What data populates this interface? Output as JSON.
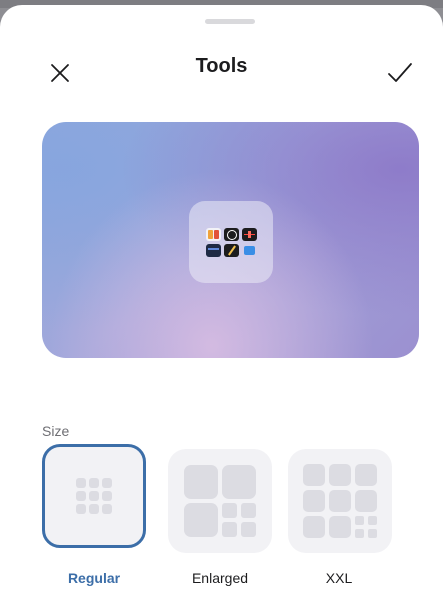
{
  "header": {
    "title": "Tools",
    "close_icon": "close-icon",
    "confirm_icon": "checkmark-icon"
  },
  "preview": {
    "folder_apps": [
      "finder-app-icon",
      "clock-app-icon",
      "voice-memos-app-icon",
      "notes-app-icon",
      "pencil-app-icon",
      "screen-app-icon"
    ]
  },
  "size_section": {
    "label": "Size",
    "options": [
      {
        "label": "Regular",
        "selected": true
      },
      {
        "label": "Enlarged",
        "selected": false
      },
      {
        "label": "XXL",
        "selected": false
      }
    ]
  },
  "colors": {
    "accent": "#3c6ea8",
    "sheet_background": "#ffffff",
    "option_background": "#f2f2f5",
    "tile": "#dcdce2"
  }
}
